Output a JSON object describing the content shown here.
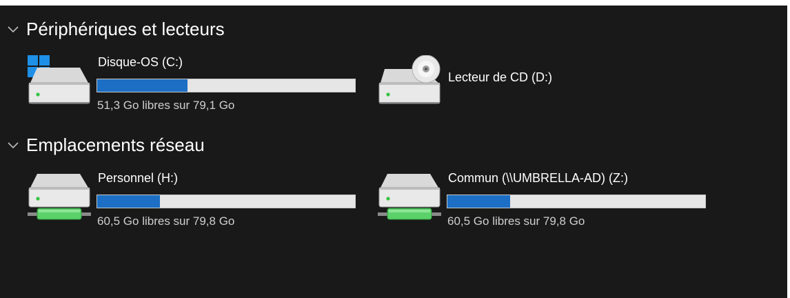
{
  "groups": [
    {
      "title": "Périphériques et lecteurs",
      "drives": [
        {
          "name": "Disque-OS (C:)",
          "space": "51,3 Go libres sur 79,1 Go",
          "used_fraction": 0.351,
          "icon": "system-drive-icon"
        },
        {
          "name": "Lecteur de CD (D:)",
          "space": "",
          "used_fraction": null,
          "icon": "cd-drive-icon"
        }
      ]
    },
    {
      "title": "Emplacements réseau",
      "drives": [
        {
          "name": "Personnel (H:)",
          "space": "60,5 Go libres sur 79,8 Go",
          "used_fraction": 0.242,
          "icon": "network-drive-icon"
        },
        {
          "name": "Commun (\\\\UMBRELLA-AD) (Z:)",
          "space": "60,5 Go libres sur 79,8 Go",
          "used_fraction": 0.242,
          "icon": "network-drive-icon"
        }
      ]
    }
  ],
  "colors": {
    "background": "#191919",
    "bar_fill": "#1c6fc4",
    "bar_track": "#e6e6e6",
    "network_accent": "#5bd16a"
  }
}
